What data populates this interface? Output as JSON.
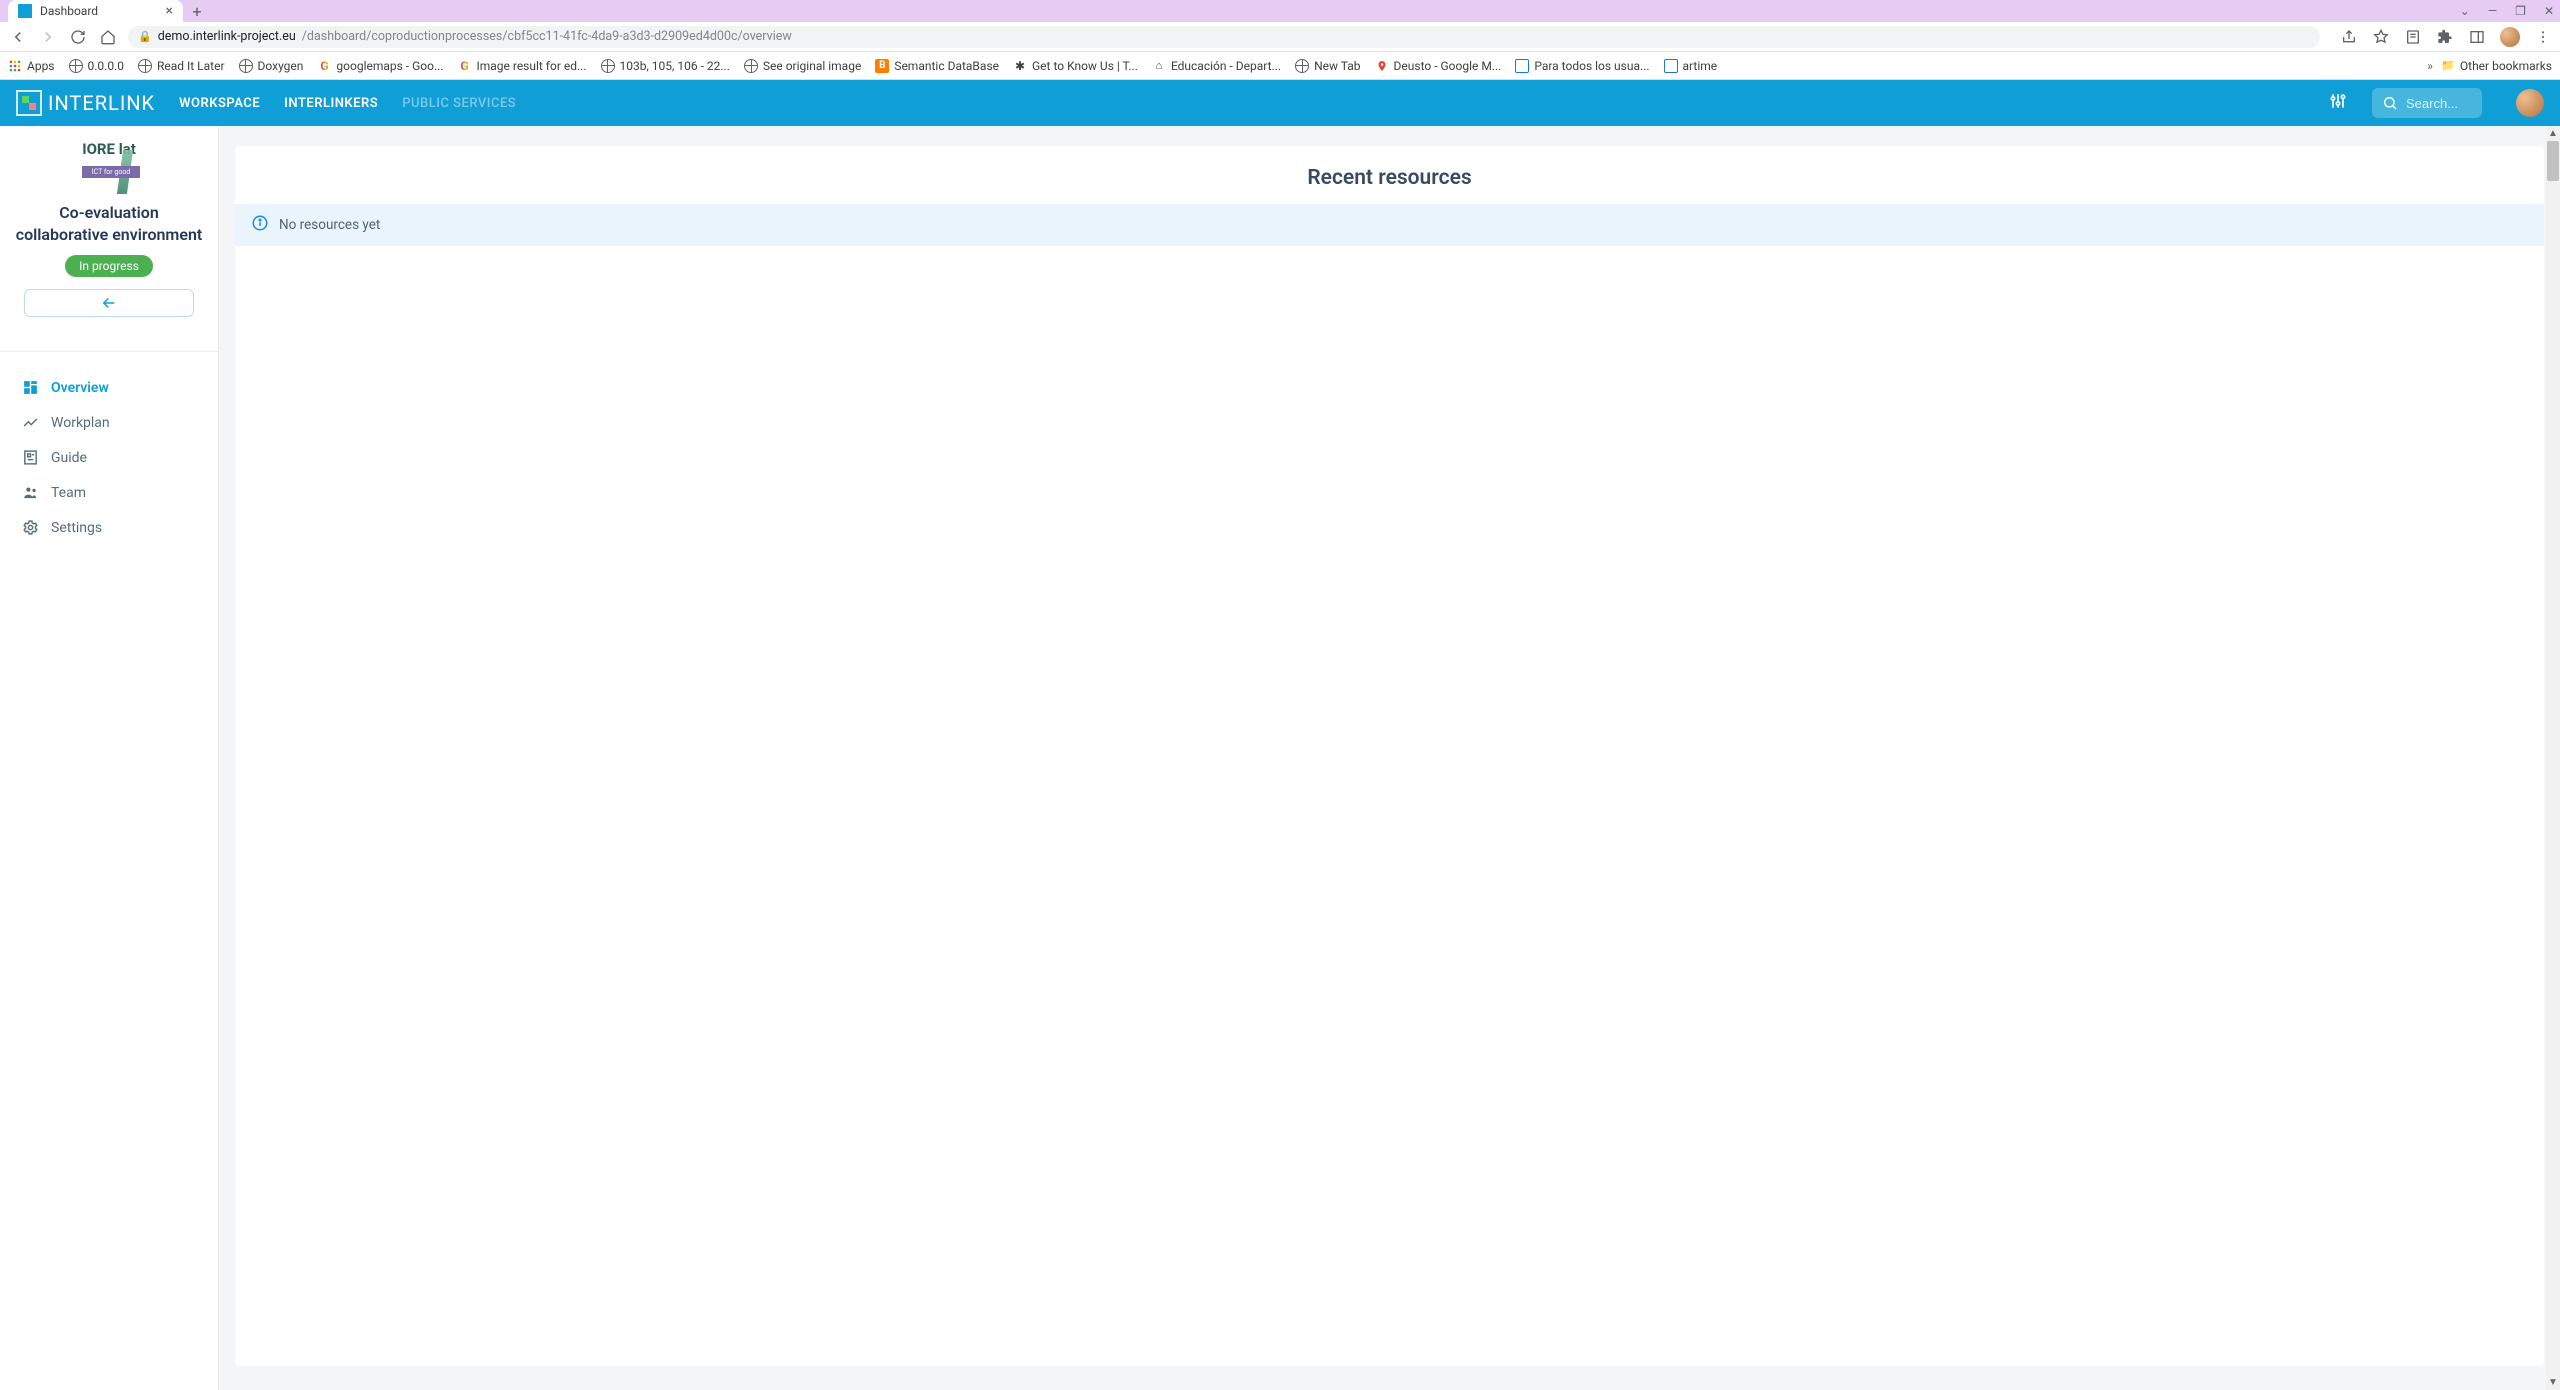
{
  "browser": {
    "tab_title": "Dashboard",
    "url_host": "demo.interlink-project.eu",
    "url_path": "/dashboard/coproductionprocesses/cbf5cc11-41fc-4da9-a3d3-d2909ed4d00c/overview",
    "bookmarks": [
      {
        "label": "Apps",
        "kind": "grid"
      },
      {
        "label": "0.0.0.0",
        "kind": "globe"
      },
      {
        "label": "Read It Later",
        "kind": "globe"
      },
      {
        "label": "Doxygen",
        "kind": "globe"
      },
      {
        "label": "googlemaps - Goo...",
        "kind": "g"
      },
      {
        "label": "Image result for ed...",
        "kind": "g"
      },
      {
        "label": "103b, 105, 106 - 22...",
        "kind": "globe"
      },
      {
        "label": "See original image",
        "kind": "globe"
      },
      {
        "label": "Semantic DataBase",
        "kind": "b"
      },
      {
        "label": "Get to Know Us | T...",
        "kind": "bug"
      },
      {
        "label": "Educación - Depart...",
        "kind": "home"
      },
      {
        "label": "New Tab",
        "kind": "globe"
      },
      {
        "label": "Deusto - Google M...",
        "kind": "pin"
      },
      {
        "label": "Para todos los usua...",
        "kind": "box"
      },
      {
        "label": "artime",
        "kind": "box"
      }
    ],
    "other_bookmarks": "Other bookmarks"
  },
  "header": {
    "logo_text": "INTERLINK",
    "nav": [
      {
        "label": "WORKSPACE",
        "active": true
      },
      {
        "label": "INTERLINKERS",
        "active": true
      },
      {
        "label": "PUBLIC SERVICES",
        "active": false
      }
    ],
    "search_placeholder": "Search..."
  },
  "sidebar": {
    "org_text": "IORE lat",
    "org_tag": "ICT for good",
    "project_title": "Co-evaluation collaborative environment",
    "status": "In progress",
    "items": [
      {
        "label": "Overview",
        "icon": "dashboard",
        "active": true
      },
      {
        "label": "Workplan",
        "icon": "timeline",
        "active": false
      },
      {
        "label": "Guide",
        "icon": "guide",
        "active": false
      },
      {
        "label": "Team",
        "icon": "people",
        "active": false
      },
      {
        "label": "Settings",
        "icon": "gear",
        "active": false
      }
    ]
  },
  "main": {
    "title": "Recent resources",
    "empty_msg": "No resources yet"
  }
}
